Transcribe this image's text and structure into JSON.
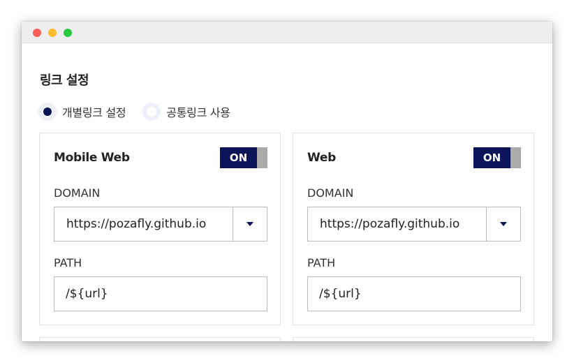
{
  "section_title": "링크 설정",
  "radio_options": [
    {
      "label": "개별링크 설정",
      "checked": true
    },
    {
      "label": "공통링크 사용",
      "checked": false
    }
  ],
  "cards": [
    {
      "title": "Mobile Web",
      "toggle_label": "ON",
      "domain_label": "DOMAIN",
      "domain_value": "https://pozafly.github.io",
      "path_label": "PATH",
      "path_value": "/${url}"
    },
    {
      "title": "Web",
      "toggle_label": "ON",
      "domain_label": "DOMAIN",
      "domain_value": "https://pozafly.github.io",
      "path_label": "PATH",
      "path_value": "/${url}"
    }
  ],
  "colors": {
    "accent": "#0b1459",
    "toggle_off": "#aaaaaa",
    "border": "#bbbbbb"
  }
}
